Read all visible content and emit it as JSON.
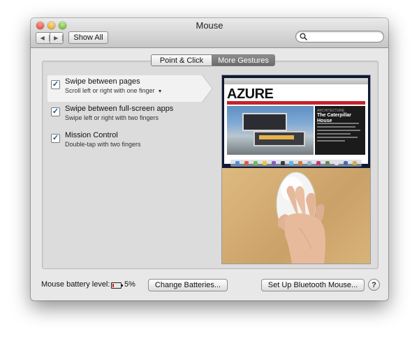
{
  "window": {
    "title": "Mouse"
  },
  "toolbar": {
    "back_icon": "chevron-left-icon",
    "forward_icon": "chevron-right-icon",
    "show_all_label": "Show All",
    "search_icon": "search-icon",
    "search_value": ""
  },
  "tabs": [
    {
      "label": "Point & Click",
      "selected": false
    },
    {
      "label": "More Gestures",
      "selected": true
    }
  ],
  "gestures": [
    {
      "title": "Swipe between pages",
      "subtitle": "Scroll left or right with one finger",
      "has_dropdown": true,
      "checked": true,
      "selected": true
    },
    {
      "title": "Swipe between full-screen apps",
      "subtitle": "Swipe left or right with two fingers",
      "checked": true
    },
    {
      "title": "Mission Control",
      "subtitle": "Double-tap with two fingers",
      "checked": true
    }
  ],
  "preview": {
    "site_logo": "AZURE",
    "article_kicker": "ARCHITECTURE",
    "article_headline": "The Caterpillar House"
  },
  "footer": {
    "battery_label": "Mouse battery level:",
    "battery_percent": "5%",
    "change_batteries_label": "Change Batteries...",
    "bluetooth_label": "Set Up Bluetooth Mouse...",
    "help_label": "?"
  },
  "colors": {
    "accent": "#1a4f9e",
    "battery_low": "#d02020",
    "selected_tab": "#7a7a7a"
  }
}
